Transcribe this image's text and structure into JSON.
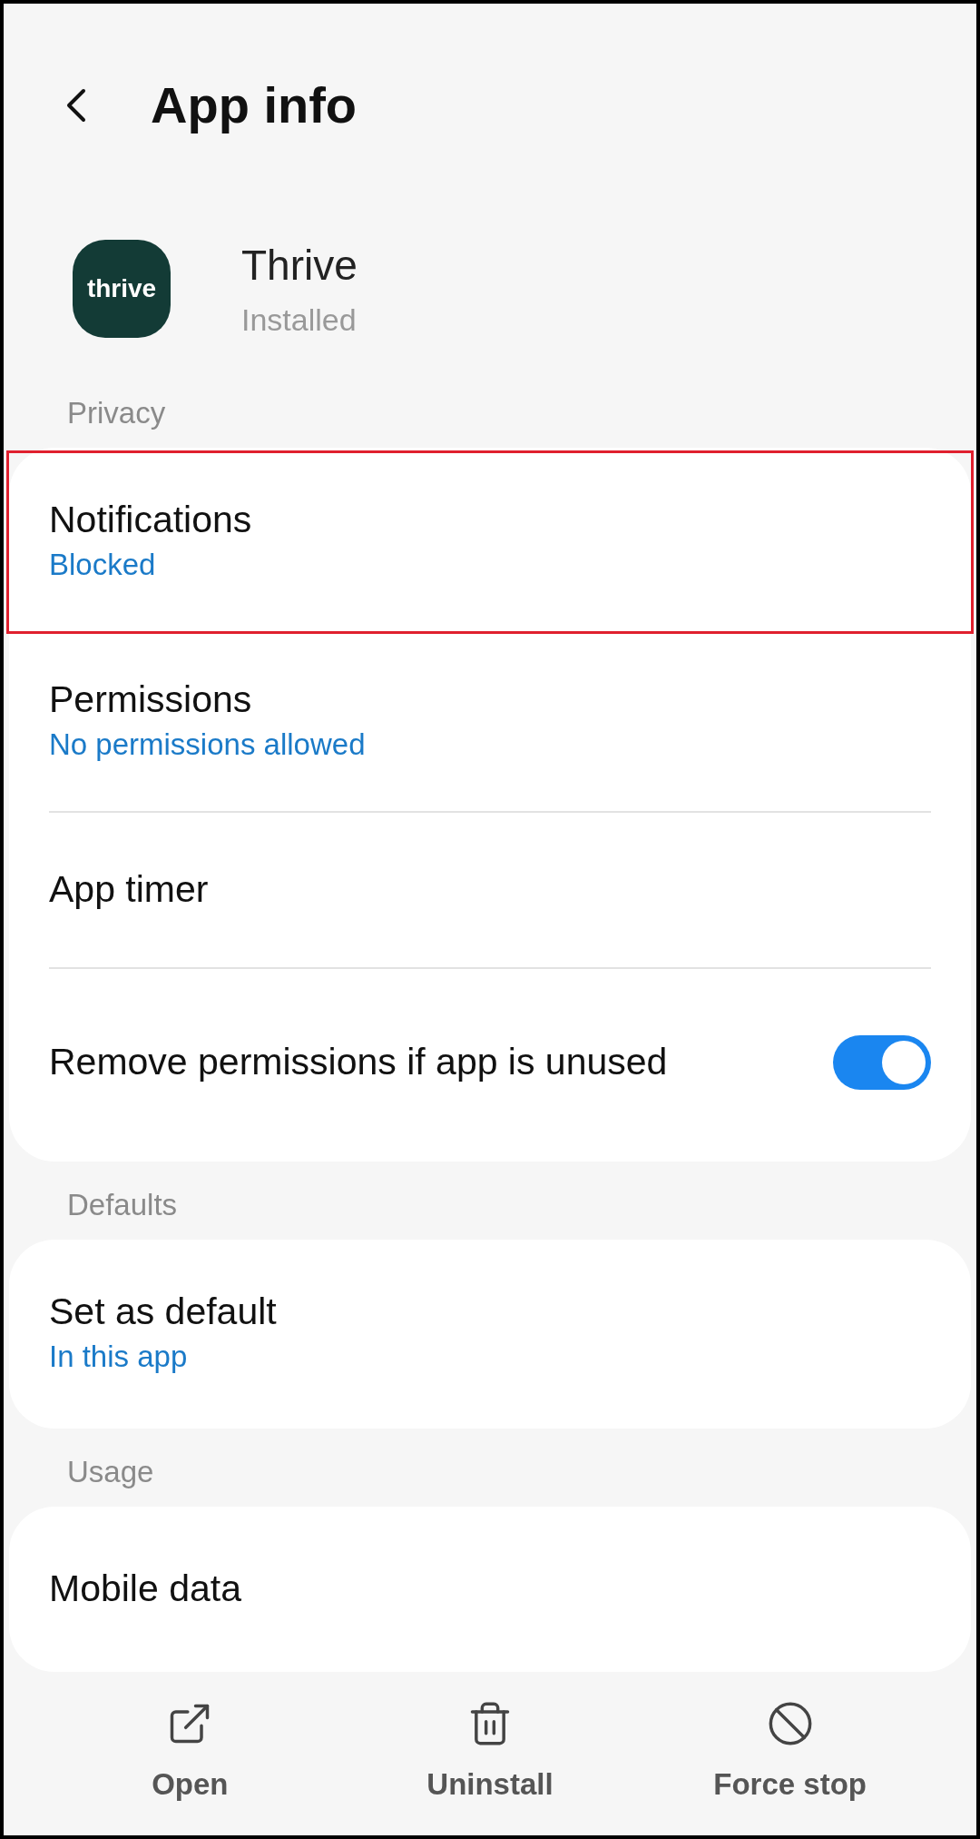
{
  "header": {
    "title": "App info"
  },
  "app": {
    "name": "Thrive",
    "status": "Installed",
    "logo_text": "thrive"
  },
  "sections": [
    {
      "label": "Privacy",
      "items": [
        {
          "kind": "link",
          "title": "Notifications",
          "subtitle": "Blocked",
          "highlighted": true
        },
        {
          "kind": "link",
          "title": "Permissions",
          "subtitle": "No permissions allowed",
          "highlighted": false
        },
        {
          "kind": "link",
          "title": "App timer",
          "highlighted": false
        },
        {
          "kind": "switch",
          "title": "Remove permissions if app is unused",
          "on": true,
          "highlighted": false
        }
      ]
    },
    {
      "label": "Defaults",
      "items": [
        {
          "kind": "link",
          "title": "Set as default",
          "subtitle": "In this app",
          "highlighted": false
        }
      ]
    },
    {
      "label": "Usage",
      "items": [
        {
          "kind": "link",
          "title": "Mobile data",
          "highlighted": false
        }
      ]
    }
  ],
  "bottom_bar": [
    {
      "kind": "open",
      "label": "Open"
    },
    {
      "kind": "uninstall",
      "label": "Uninstall"
    },
    {
      "kind": "stop",
      "label": "Force stop"
    }
  ]
}
